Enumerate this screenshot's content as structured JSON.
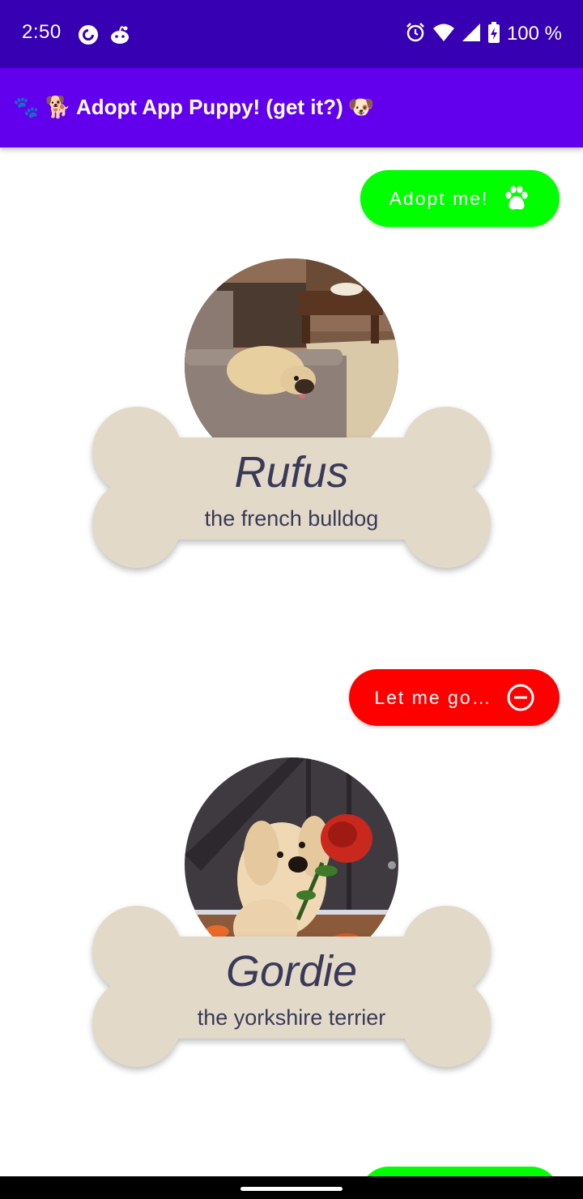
{
  "status_bar": {
    "time": "2:50",
    "battery": "100 %",
    "icons": [
      "pocket-casts-icon",
      "reddit-icon",
      "alarm-icon",
      "wifi-icon",
      "cell-signal-icon",
      "battery-charging-icon"
    ]
  },
  "app_bar": {
    "title": "Adopt App Puppy! (get it?)",
    "leading_emoji": "🐾 🐕",
    "trailing_emoji": "🐶",
    "color": "#6200ee"
  },
  "pets": [
    {
      "name": "Rufus",
      "breed": "the french bulldog",
      "action_label": "Adopt me!",
      "action_icon": "paw-icon",
      "action_color": "#00ff00"
    },
    {
      "name": "Gordie",
      "breed": "the yorkshire terrier",
      "action_label": "Let me go…",
      "action_icon": "remove-circle-icon",
      "action_color": "#ff0000"
    }
  ],
  "colors": {
    "status_bar": "#3700b3",
    "bone": "#e2d9c9",
    "text": "#3a3a58"
  }
}
